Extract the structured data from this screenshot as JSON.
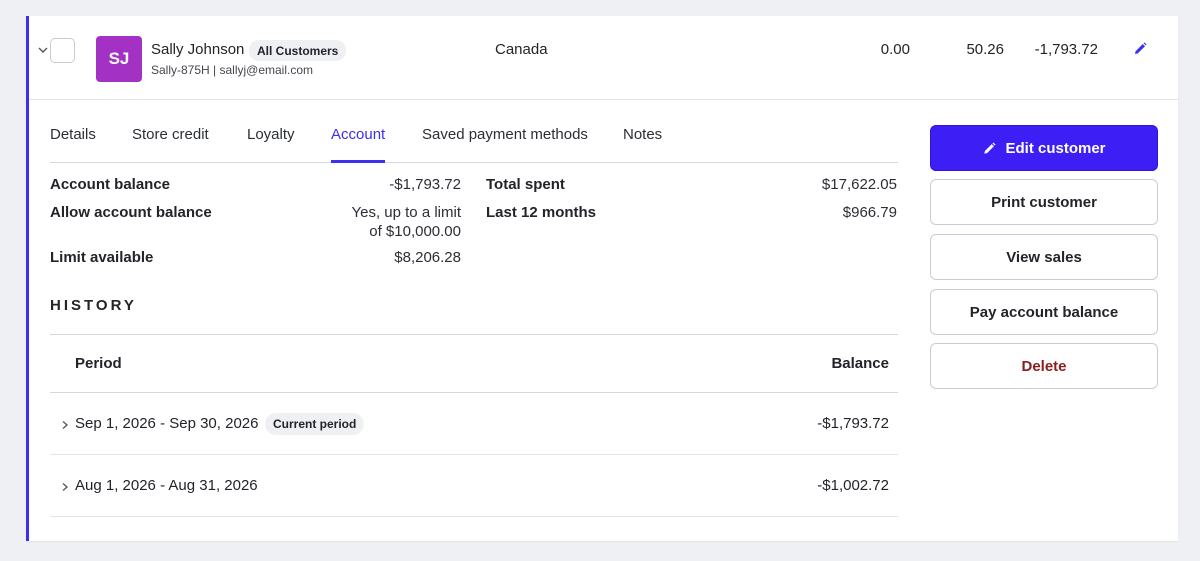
{
  "customer": {
    "initials": "SJ",
    "name": "Sally Johnson",
    "group": "All Customers",
    "sub": "Sally-875H | sallyj@email.com",
    "country": "Canada",
    "col1": "0.00",
    "col2": "50.26",
    "col3": "-1,793.72",
    "avatar_color": "#a332c4"
  },
  "tabs": [
    {
      "label": "Details"
    },
    {
      "label": "Store credit"
    },
    {
      "label": "Loyalty"
    },
    {
      "label": "Account",
      "active": true
    },
    {
      "label": "Saved payment methods"
    },
    {
      "label": "Notes"
    }
  ],
  "account": {
    "balance_label": "Account balance",
    "balance_value": "-$1,793.72",
    "allow_label": "Allow account balance",
    "allow_value_line1": "Yes, up to a limit",
    "allow_value_line2": "of $10,000.00",
    "limit_label": "Limit available",
    "limit_value": "$8,206.28",
    "total_spent_label": "Total spent",
    "total_spent_value": "$17,622.05",
    "last12_label": "Last 12 months",
    "last12_value": "$966.79"
  },
  "history": {
    "title": "HISTORY",
    "col_period": "Period",
    "col_balance": "Balance",
    "rows": [
      {
        "period": "Sep 1, 2026 - Sep 30, 2026",
        "badge": "Current period",
        "balance": "-$1,793.72"
      },
      {
        "period": "Aug 1, 2026 - Aug 31, 2026",
        "badge": "",
        "balance": "-$1,002.72"
      }
    ]
  },
  "actions": {
    "edit": "Edit customer",
    "print": "Print customer",
    "view_sales": "View sales",
    "pay": "Pay account balance",
    "delete": "Delete"
  },
  "colors": {
    "accent": "#3d2ef0",
    "primary_button": "#3d1ef5",
    "danger_text": "#8a1d1d"
  }
}
